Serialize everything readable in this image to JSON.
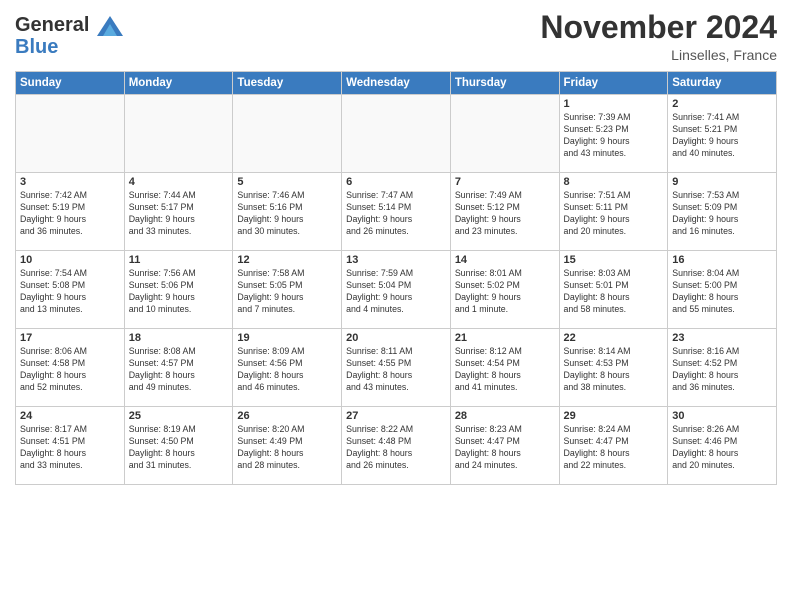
{
  "header": {
    "logo_line1": "General",
    "logo_line2": "Blue",
    "month": "November 2024",
    "location": "Linselles, France"
  },
  "weekdays": [
    "Sunday",
    "Monday",
    "Tuesday",
    "Wednesday",
    "Thursday",
    "Friday",
    "Saturday"
  ],
  "weeks": [
    [
      {
        "day": "",
        "info": ""
      },
      {
        "day": "",
        "info": ""
      },
      {
        "day": "",
        "info": ""
      },
      {
        "day": "",
        "info": ""
      },
      {
        "day": "",
        "info": ""
      },
      {
        "day": "1",
        "info": "Sunrise: 7:39 AM\nSunset: 5:23 PM\nDaylight: 9 hours\nand 43 minutes."
      },
      {
        "day": "2",
        "info": "Sunrise: 7:41 AM\nSunset: 5:21 PM\nDaylight: 9 hours\nand 40 minutes."
      }
    ],
    [
      {
        "day": "3",
        "info": "Sunrise: 7:42 AM\nSunset: 5:19 PM\nDaylight: 9 hours\nand 36 minutes."
      },
      {
        "day": "4",
        "info": "Sunrise: 7:44 AM\nSunset: 5:17 PM\nDaylight: 9 hours\nand 33 minutes."
      },
      {
        "day": "5",
        "info": "Sunrise: 7:46 AM\nSunset: 5:16 PM\nDaylight: 9 hours\nand 30 minutes."
      },
      {
        "day": "6",
        "info": "Sunrise: 7:47 AM\nSunset: 5:14 PM\nDaylight: 9 hours\nand 26 minutes."
      },
      {
        "day": "7",
        "info": "Sunrise: 7:49 AM\nSunset: 5:12 PM\nDaylight: 9 hours\nand 23 minutes."
      },
      {
        "day": "8",
        "info": "Sunrise: 7:51 AM\nSunset: 5:11 PM\nDaylight: 9 hours\nand 20 minutes."
      },
      {
        "day": "9",
        "info": "Sunrise: 7:53 AM\nSunset: 5:09 PM\nDaylight: 9 hours\nand 16 minutes."
      }
    ],
    [
      {
        "day": "10",
        "info": "Sunrise: 7:54 AM\nSunset: 5:08 PM\nDaylight: 9 hours\nand 13 minutes."
      },
      {
        "day": "11",
        "info": "Sunrise: 7:56 AM\nSunset: 5:06 PM\nDaylight: 9 hours\nand 10 minutes."
      },
      {
        "day": "12",
        "info": "Sunrise: 7:58 AM\nSunset: 5:05 PM\nDaylight: 9 hours\nand 7 minutes."
      },
      {
        "day": "13",
        "info": "Sunrise: 7:59 AM\nSunset: 5:04 PM\nDaylight: 9 hours\nand 4 minutes."
      },
      {
        "day": "14",
        "info": "Sunrise: 8:01 AM\nSunset: 5:02 PM\nDaylight: 9 hours\nand 1 minute."
      },
      {
        "day": "15",
        "info": "Sunrise: 8:03 AM\nSunset: 5:01 PM\nDaylight: 8 hours\nand 58 minutes."
      },
      {
        "day": "16",
        "info": "Sunrise: 8:04 AM\nSunset: 5:00 PM\nDaylight: 8 hours\nand 55 minutes."
      }
    ],
    [
      {
        "day": "17",
        "info": "Sunrise: 8:06 AM\nSunset: 4:58 PM\nDaylight: 8 hours\nand 52 minutes."
      },
      {
        "day": "18",
        "info": "Sunrise: 8:08 AM\nSunset: 4:57 PM\nDaylight: 8 hours\nand 49 minutes."
      },
      {
        "day": "19",
        "info": "Sunrise: 8:09 AM\nSunset: 4:56 PM\nDaylight: 8 hours\nand 46 minutes."
      },
      {
        "day": "20",
        "info": "Sunrise: 8:11 AM\nSunset: 4:55 PM\nDaylight: 8 hours\nand 43 minutes."
      },
      {
        "day": "21",
        "info": "Sunrise: 8:12 AM\nSunset: 4:54 PM\nDaylight: 8 hours\nand 41 minutes."
      },
      {
        "day": "22",
        "info": "Sunrise: 8:14 AM\nSunset: 4:53 PM\nDaylight: 8 hours\nand 38 minutes."
      },
      {
        "day": "23",
        "info": "Sunrise: 8:16 AM\nSunset: 4:52 PM\nDaylight: 8 hours\nand 36 minutes."
      }
    ],
    [
      {
        "day": "24",
        "info": "Sunrise: 8:17 AM\nSunset: 4:51 PM\nDaylight: 8 hours\nand 33 minutes."
      },
      {
        "day": "25",
        "info": "Sunrise: 8:19 AM\nSunset: 4:50 PM\nDaylight: 8 hours\nand 31 minutes."
      },
      {
        "day": "26",
        "info": "Sunrise: 8:20 AM\nSunset: 4:49 PM\nDaylight: 8 hours\nand 28 minutes."
      },
      {
        "day": "27",
        "info": "Sunrise: 8:22 AM\nSunset: 4:48 PM\nDaylight: 8 hours\nand 26 minutes."
      },
      {
        "day": "28",
        "info": "Sunrise: 8:23 AM\nSunset: 4:47 PM\nDaylight: 8 hours\nand 24 minutes."
      },
      {
        "day": "29",
        "info": "Sunrise: 8:24 AM\nSunset: 4:47 PM\nDaylight: 8 hours\nand 22 minutes."
      },
      {
        "day": "30",
        "info": "Sunrise: 8:26 AM\nSunset: 4:46 PM\nDaylight: 8 hours\nand 20 minutes."
      }
    ]
  ]
}
